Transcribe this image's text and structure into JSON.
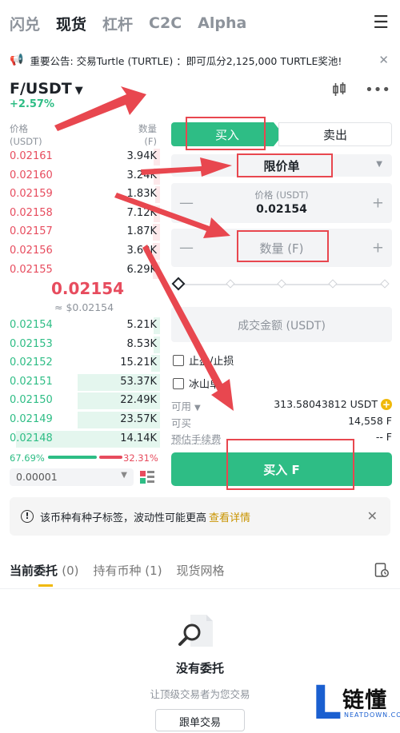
{
  "nav": {
    "tabs": [
      "闪兑",
      "现货",
      "杠杆",
      "C2C",
      "Alpha"
    ],
    "active": 1
  },
  "notice": {
    "text": "重要公告: 交易Turtle (TURTLE) ：即可瓜分2,125,000 TURTLE奖池!"
  },
  "pair": {
    "name": "F/USDT",
    "change": "+2.57%"
  },
  "orderbook": {
    "price_header": "价格",
    "price_unit": "(USDT)",
    "qty_header": "数量",
    "qty_unit": "(F)",
    "asks": [
      {
        "price": "0.02161",
        "qty": "3.94K",
        "depth": 0.04
      },
      {
        "price": "0.02160",
        "qty": "3.24K",
        "depth": 0.04
      },
      {
        "price": "0.02159",
        "qty": "1.83K",
        "depth": 0.03
      },
      {
        "price": "0.02158",
        "qty": "7.12K",
        "depth": 0.04
      },
      {
        "price": "0.02157",
        "qty": "1.87K",
        "depth": 0.05
      },
      {
        "price": "0.02156",
        "qty": "3.60K",
        "depth": 0.05
      },
      {
        "price": "0.02155",
        "qty": "6.29K",
        "depth": 0.05
      }
    ],
    "last_price": "0.02154",
    "last_fiat": "≈ $0.02154",
    "bids": [
      {
        "price": "0.02154",
        "qty": "5.21K",
        "depth": 0.04
      },
      {
        "price": "0.02153",
        "qty": "8.53K",
        "depth": 0.04
      },
      {
        "price": "0.02152",
        "qty": "15.21K",
        "depth": 0.06
      },
      {
        "price": "0.02151",
        "qty": "53.37K",
        "depth": 0.55
      },
      {
        "price": "0.02150",
        "qty": "22.49K",
        "depth": 0.55
      },
      {
        "price": "0.02149",
        "qty": "23.57K",
        "depth": 0.55
      },
      {
        "price": "0.02148",
        "qty": "14.14K",
        "depth": 0.96
      }
    ],
    "buy_ratio": "67.69%",
    "sell_ratio": "32.31%",
    "buy_ratio_value": 0.6769,
    "tick_size": "0.00001"
  },
  "order_form": {
    "buy_label": "买入",
    "sell_label": "卖出",
    "order_type": "限价单",
    "price_label": "价格 (USDT)",
    "price_value": "0.02154",
    "qty_placeholder": "数量 (F)",
    "total_placeholder": "成交金额 (USDT)",
    "tp_sl": "止盈/止损",
    "iceberg": "冰山单",
    "available_label": "可用",
    "available_value": "313.58043812 USDT",
    "can_buy_label": "可买",
    "can_buy_value": "14,558 F",
    "fee_label": "预估手续费",
    "fee_value": "-- F",
    "submit": "买入 F"
  },
  "alert": {
    "text": "该币种有种子标签，波动性可能更高",
    "link": "查看详情"
  },
  "bottom_tabs": [
    {
      "label": "当前委托",
      "count": "(0)"
    },
    {
      "label": "持有币种",
      "count": "(1)"
    },
    {
      "label": "现货网格",
      "count": ""
    }
  ],
  "empty": {
    "title": "没有委托",
    "subtitle": "让顶级交易者为您交易",
    "button": "跟单交易"
  },
  "watermark": {
    "cn": "链懂",
    "en": "NEATDOWN.COM"
  },
  "colors": {
    "buy": "#2ebd85",
    "sell": "#e74c5e",
    "accent": "#f0b90b",
    "annotation": "#e8474f"
  }
}
